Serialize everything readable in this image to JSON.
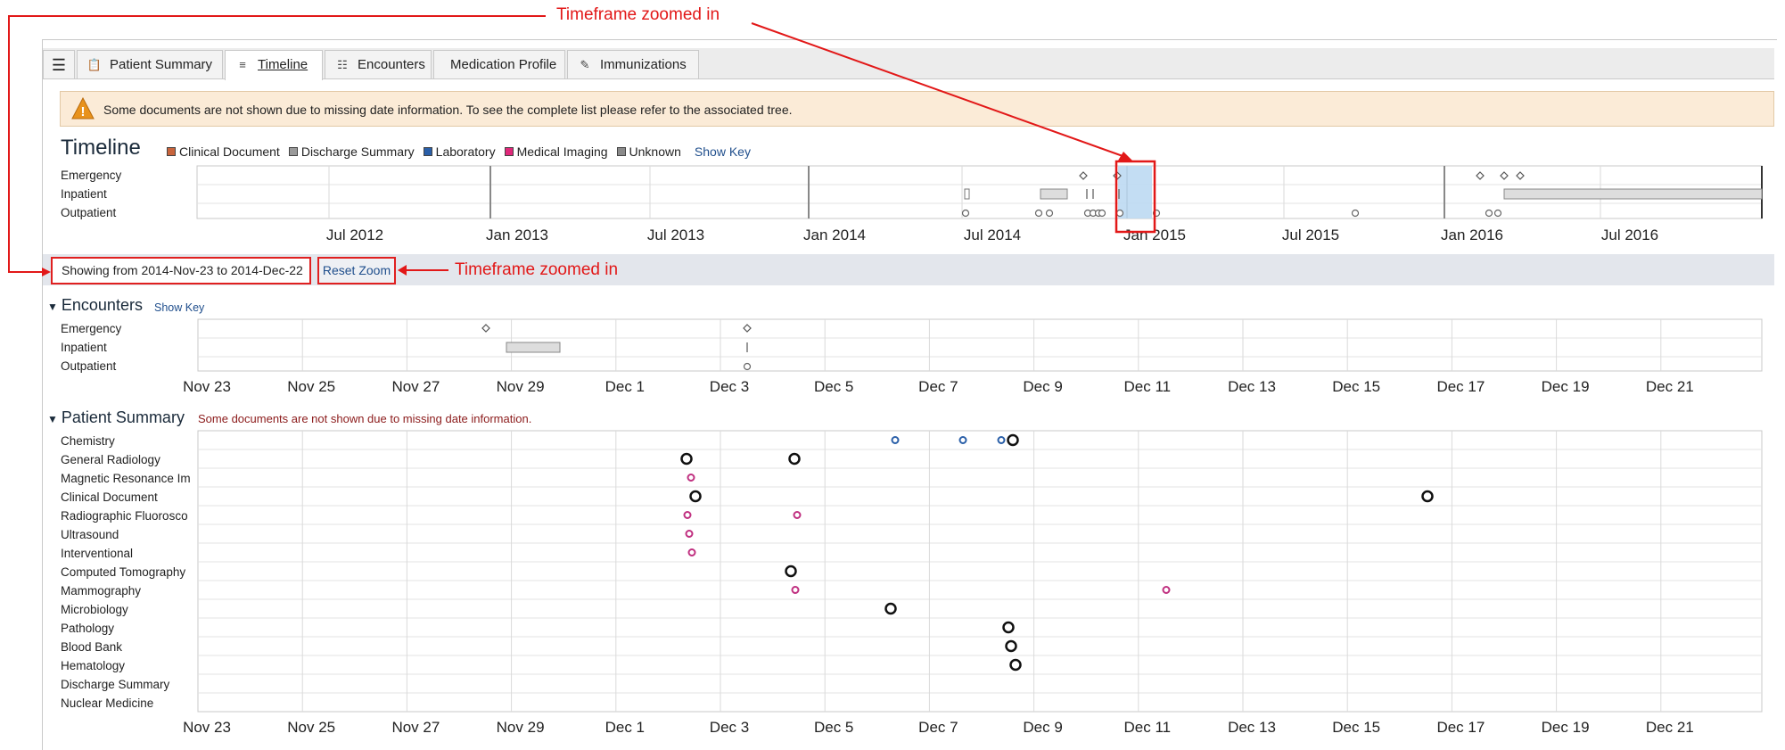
{
  "tabs": [
    {
      "label": "Patient Summary",
      "icon": "clipboard-icon"
    },
    {
      "label": "Timeline",
      "icon": "timeline-icon"
    },
    {
      "label": "Encounters",
      "icon": "list-icon"
    },
    {
      "label": "Medication Profile",
      "icon": ""
    },
    {
      "label": "Immunizations",
      "icon": "syringe-icon"
    }
  ],
  "menu_icon": "hamburger-menu-icon",
  "warning": {
    "text": "Some documents are not shown due to missing date information. To see the complete list please refer to the associated tree.",
    "icon": "warning-icon"
  },
  "timeline": {
    "title": "Timeline",
    "legend": [
      {
        "label": "Clinical Document",
        "color": "#c8643c"
      },
      {
        "label": "Discharge Summary",
        "color": "#9a9a9a"
      },
      {
        "label": "Laboratory",
        "color": "#2a5fa8"
      },
      {
        "label": "Medical Imaging",
        "color": "#e0287a"
      },
      {
        "label": "Unknown",
        "color": "#8a8a8a"
      }
    ],
    "show_key": "Show Key",
    "rows": [
      "Emergency",
      "Inpatient",
      "Outpatient"
    ],
    "ticks": [
      "Jul 2012",
      "Jan 2013",
      "Jul 2013",
      "Jan 2014",
      "Jul 2014",
      "Jan 2015",
      "Jul 2015",
      "Jan 2016",
      "Jul 2016"
    ]
  },
  "zoom": {
    "showing": "Showing from 2014-Nov-23 to 2014-Dec-22",
    "reset": "Reset Zoom"
  },
  "annotations": {
    "top": "Timeframe zoomed in",
    "side": "Timeframe zoomed in"
  },
  "encounters": {
    "title": "Encounters",
    "show_key": "Show Key",
    "rows": [
      "Emergency",
      "Inpatient",
      "Outpatient"
    ]
  },
  "day_ticks": [
    "Nov 23",
    "Nov 25",
    "Nov 27",
    "Nov 29",
    "Dec 1",
    "Dec 3",
    "Dec 5",
    "Dec 7",
    "Dec 9",
    "Dec 11",
    "Dec 13",
    "Dec 15",
    "Dec 17",
    "Dec 19",
    "Dec 21"
  ],
  "patient_summary": {
    "title": "Patient Summary",
    "note": "Some documents are not shown due to missing date information.",
    "rows": [
      "Chemistry",
      "General Radiology",
      "Magnetic Resonance Im",
      "Clinical Document",
      "Radiographic Fluorosco",
      "Ultrasound",
      "Interventional",
      "Computed Tomography",
      "Mammography",
      "Microbiology",
      "Pathology",
      "Blood Bank",
      "Hematology",
      "Discharge Summary",
      "Nuclear Medicine"
    ]
  },
  "colors": {
    "laboratory": "#2a5fa8",
    "imaging": "#c03080",
    "document": "#111111",
    "annotation": "#e21818"
  }
}
